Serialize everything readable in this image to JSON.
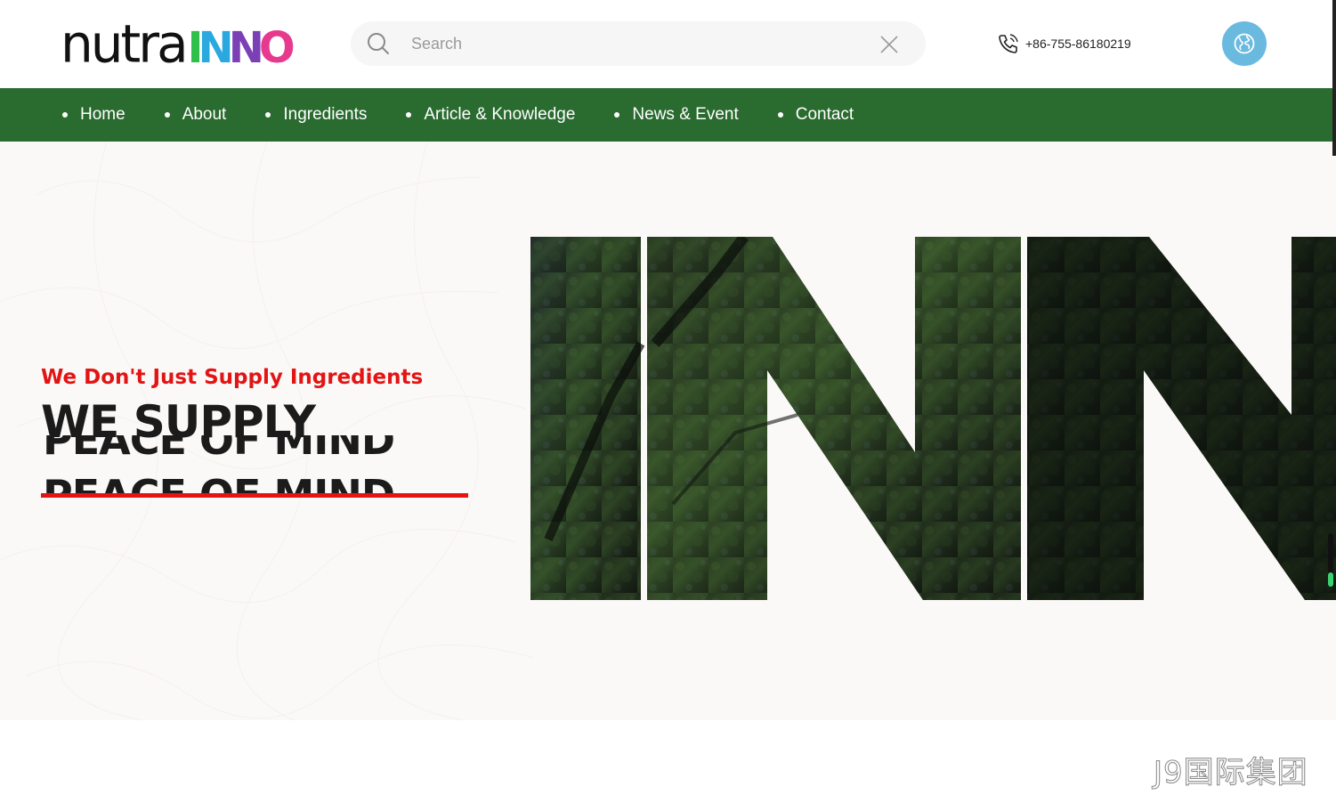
{
  "header": {
    "logo_text": "nutra",
    "logo_mark": [
      "I",
      "N",
      "N",
      "O"
    ],
    "search": {
      "placeholder": "Search",
      "value": ""
    },
    "phone": "+86-755-86180219",
    "icons": {
      "search": "search-icon",
      "close": "close-icon",
      "phone": "phone-icon",
      "globe": "globe-icon"
    }
  },
  "nav": {
    "items": [
      {
        "label": "Home"
      },
      {
        "label": "About"
      },
      {
        "label": "Ingredients"
      },
      {
        "label": "Article & Knowledge"
      },
      {
        "label": "News & Event"
      },
      {
        "label": "Contact"
      }
    ]
  },
  "hero": {
    "tagline": "We Don't Just Supply Ingredients",
    "headline": "WE SUPPLY",
    "rotating_words": [
      "PEACE OF MIND",
      "PEACE OF MIND"
    ],
    "art_text": "INN"
  },
  "watermark": "J9国际集团",
  "colors": {
    "nav_bg": "#2a6b30",
    "accent_red": "#e31414",
    "globe_bg": "#6ab9df",
    "hero_bg": "#fbf9f7"
  }
}
